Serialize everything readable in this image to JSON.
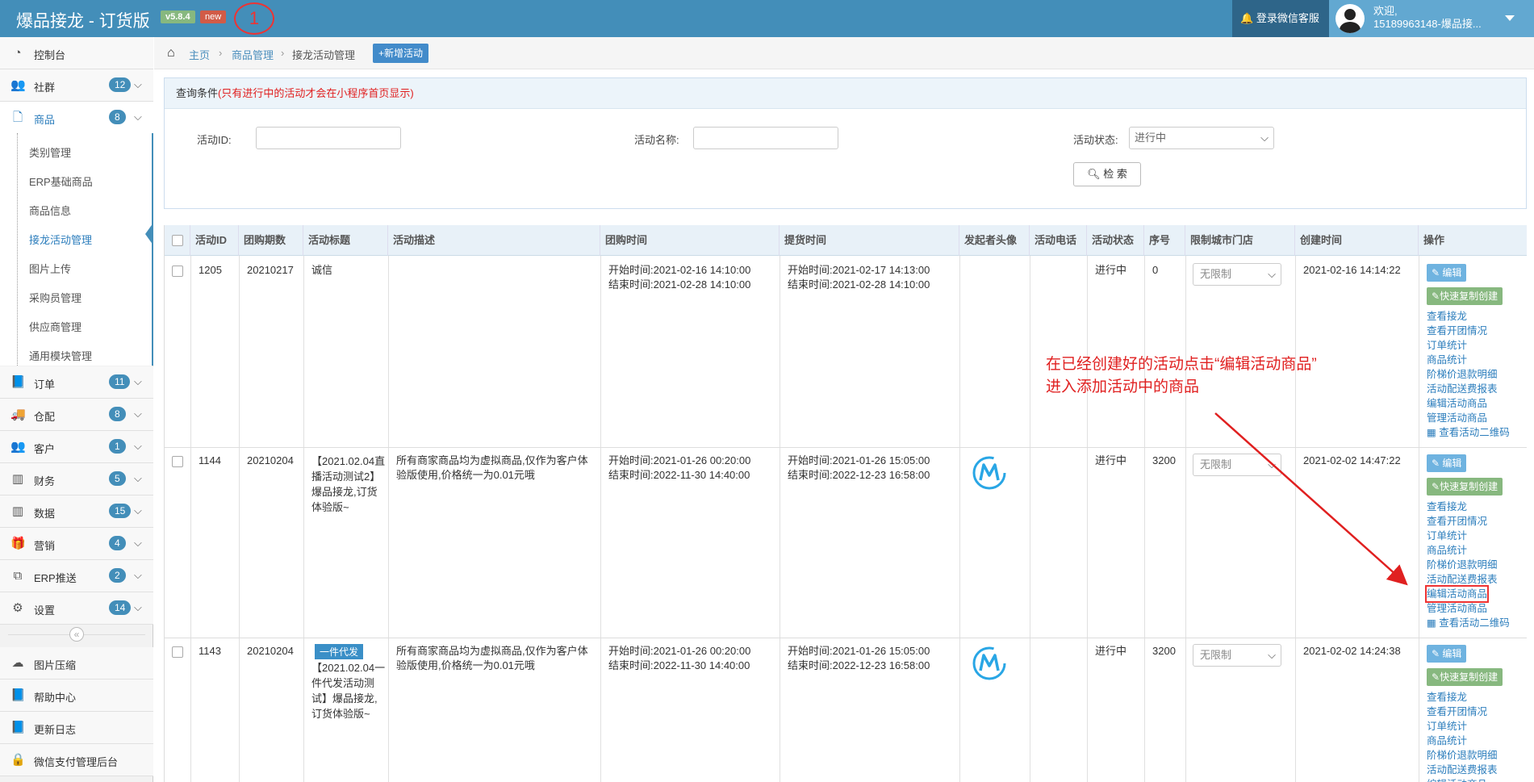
{
  "header": {
    "title": "爆品接龙 - 订货版",
    "version": "v5.8.4",
    "new_badge": "new",
    "annotation_number": "1",
    "login_wechat": "登录微信客服",
    "welcome": "欢迎,",
    "username": "15189963148-爆品接..."
  },
  "sidebar": {
    "items": [
      {
        "label": "控制台"
      },
      {
        "label": "社群",
        "count": "12"
      },
      {
        "label": "商品",
        "count": "8"
      },
      {
        "label": "订单",
        "count": "11"
      },
      {
        "label": "仓配",
        "count": "8"
      },
      {
        "label": "客户",
        "count": "1"
      },
      {
        "label": "财务",
        "count": "5"
      },
      {
        "label": "数据",
        "count": "15"
      },
      {
        "label": "营销",
        "count": "4"
      },
      {
        "label": "ERP推送",
        "count": "2"
      },
      {
        "label": "设置",
        "count": "14"
      },
      {
        "label": "图片压缩"
      },
      {
        "label": "帮助中心"
      },
      {
        "label": "更新日志"
      },
      {
        "label": "微信支付管理后台"
      }
    ],
    "subitems": [
      "类别管理",
      "ERP基础商品",
      "商品信息",
      "接龙活动管理",
      "图片上传",
      "采购员管理",
      "供应商管理",
      "通用模块管理"
    ],
    "collapse_glyph": "«"
  },
  "breadcrumb": {
    "home": "主页",
    "level1": "商品管理",
    "level2": "接龙活动管理",
    "add_button": "新增活动"
  },
  "query": {
    "title": "查询条件",
    "note": "(只有进行中的活动才会在小程序首页显示)",
    "id_label": "活动ID:",
    "name_label": "活动名称:",
    "status_label": "活动状态:",
    "status_value": "进行中",
    "search_button": "检 索"
  },
  "table": {
    "headers": [
      "活动ID",
      "团购期数",
      "活动标题",
      "活动描述",
      "团购时间",
      "提货时间",
      "发起者头像",
      "活动电话",
      "活动状态",
      "序号",
      "限制城市门店",
      "创建时间",
      "操作"
    ],
    "rows": [
      {
        "id": "1205",
        "period": "20210217",
        "title": "诚信",
        "tag": "",
        "desc": "",
        "group_start": "开始时间:2021-02-16 14:10:00",
        "group_end": "结束时间:2021-02-28 14:10:00",
        "pick_start": "开始时间:2021-02-17 14:13:00",
        "pick_end": "结束时间:2021-02-28 14:10:00",
        "status": "进行中",
        "seq": "0",
        "city": "无限制",
        "created": "2021-02-16 14:14:22"
      },
      {
        "id": "1144",
        "period": "20210204",
        "title": "【2021.02.04直播活动测试2】爆品接龙,订货体验版~",
        "tag": "",
        "desc": "所有商家商品均为虚拟商品,仅作为客户体验版使用,价格统一为0.01元哦",
        "group_start": "开始时间:2021-01-26 00:20:00",
        "group_end": "结束时间:2022-11-30 14:40:00",
        "pick_start": "开始时间:2021-01-26 15:05:00",
        "pick_end": "结束时间:2022-12-23 16:58:00",
        "status": "进行中",
        "seq": "3200",
        "city": "无限制",
        "created": "2021-02-02 14:47:22"
      },
      {
        "id": "1143",
        "period": "20210204",
        "title": "【2021.02.04一件代发活动测试】爆品接龙,订货体验版~",
        "tag": "一件代发",
        "desc": "所有商家商品均为虚拟商品,仅作为客户体验版使用,价格统一为0.01元哦",
        "group_start": "开始时间:2021-01-26 00:20:00",
        "group_end": "结束时间:2022-11-30 14:40:00",
        "pick_start": "开始时间:2021-01-26 15:05:00",
        "pick_end": "结束时间:2022-12-23 16:58:00",
        "status": "进行中",
        "seq": "3200",
        "city": "无限制",
        "created": "2021-02-02 14:24:38"
      }
    ],
    "ops": {
      "edit": "编辑",
      "copy": "快速复制创建",
      "links": [
        "查看接龙",
        "查看开团情况",
        "订单统计",
        "商品统计",
        "阶梯价退款明细",
        "活动配送费报表",
        "编辑活动商品",
        "管理活动商品",
        "查看活动二维码"
      ]
    }
  },
  "annotation": {
    "line1": "在已经创建好的活动点击“编辑活动商品”",
    "line2": "进入添加活动中的商品"
  },
  "colors": {
    "header_bg": "#438eb9",
    "accent": "#2b7dbc",
    "edit_btn": "#6fb3e0",
    "copy_btn": "#87b87f",
    "annotation": "#e02020"
  }
}
